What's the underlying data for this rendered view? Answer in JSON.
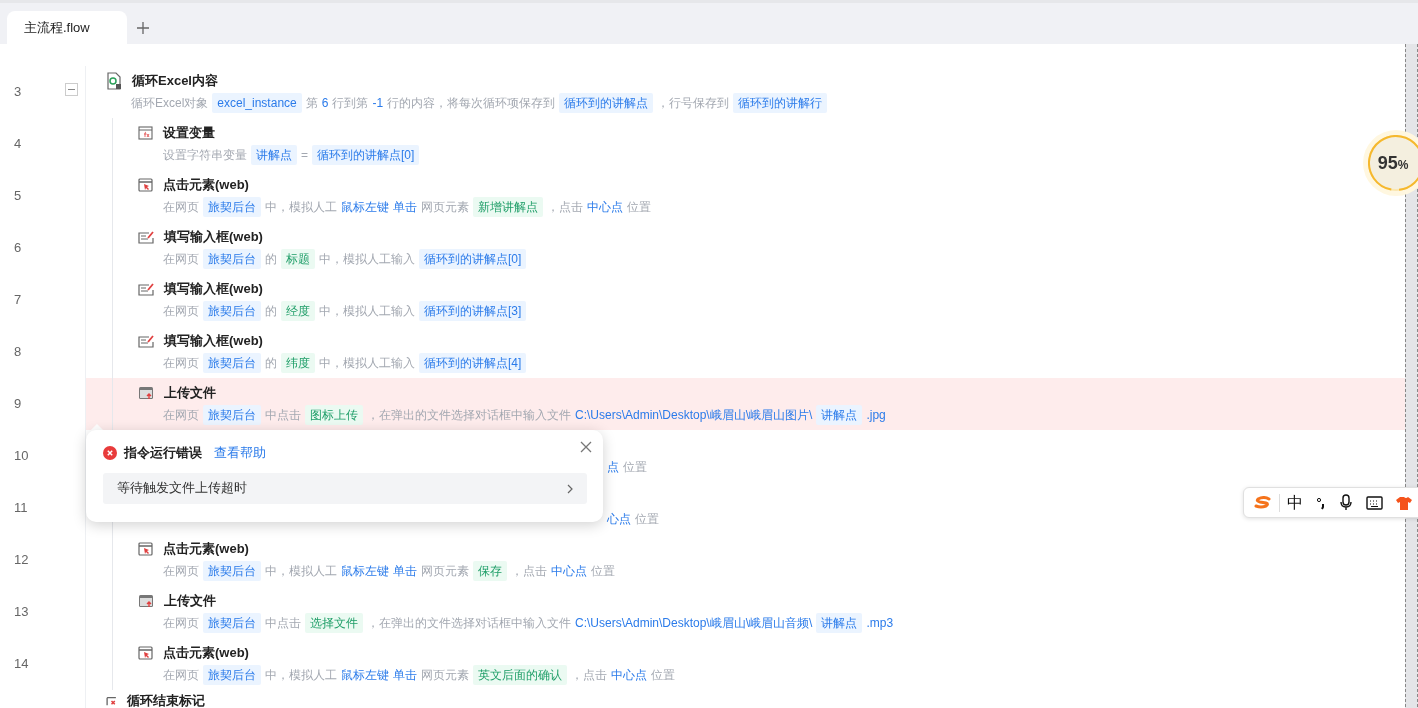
{
  "tabs": [
    {
      "label": "主流程.flow",
      "selected": true
    }
  ],
  "steps": [
    {
      "line": "3",
      "kind": "loop",
      "title": "循环Excel内容",
      "expanded": true,
      "error": false,
      "segments": [
        {
          "kind": "text",
          "text": "循环Excel对象"
        },
        {
          "kind": "var",
          "text": "excel_instance"
        },
        {
          "kind": "text",
          "text": "第"
        },
        {
          "kind": "value",
          "text": "6"
        },
        {
          "kind": "text",
          "text": "行到第"
        },
        {
          "kind": "value",
          "text": "-1"
        },
        {
          "kind": "text",
          "text": "行的内容，将每次循环项保存到"
        },
        {
          "kind": "var",
          "text": "循环到的讲解点"
        },
        {
          "kind": "text",
          "text": "，行号保存到"
        },
        {
          "kind": "var",
          "text": "循环到的讲解行"
        }
      ],
      "children": [
        {
          "line": "4",
          "kind": "set-var",
          "title": "设置变量",
          "error": false,
          "segments": [
            {
              "kind": "text",
              "text": "设置字符串变量"
            },
            {
              "kind": "var",
              "text": "讲解点"
            },
            {
              "kind": "text",
              "text": "="
            },
            {
              "kind": "var",
              "text": "循环到的讲解点[0]"
            }
          ]
        },
        {
          "line": "5",
          "kind": "click",
          "title": "点击元素(web)",
          "error": false,
          "segments": [
            {
              "kind": "text",
              "text": "在网页"
            },
            {
              "kind": "var",
              "text": "旅契后台"
            },
            {
              "kind": "text",
              "text": "中，模拟人工"
            },
            {
              "kind": "value",
              "text": "鼠标左键"
            },
            {
              "kind": "value",
              "text": "单击"
            },
            {
              "kind": "text",
              "text": "网页元素"
            },
            {
              "kind": "element",
              "text": "新增讲解点"
            },
            {
              "kind": "text",
              "text": "，点击"
            },
            {
              "kind": "value",
              "text": "中心点"
            },
            {
              "kind": "text",
              "text": "位置"
            }
          ]
        },
        {
          "line": "6",
          "kind": "input",
          "title": "填写输入框(web)",
          "error": false,
          "segments": [
            {
              "kind": "text",
              "text": "在网页"
            },
            {
              "kind": "var",
              "text": "旅契后台"
            },
            {
              "kind": "text",
              "text": "的"
            },
            {
              "kind": "element",
              "text": "标题"
            },
            {
              "kind": "text",
              "text": "中，模拟人工输入"
            },
            {
              "kind": "var",
              "text": "循环到的讲解点[0]"
            }
          ]
        },
        {
          "line": "7",
          "kind": "input",
          "title": "填写输入框(web)",
          "error": false,
          "segments": [
            {
              "kind": "text",
              "text": "在网页"
            },
            {
              "kind": "var",
              "text": "旅契后台"
            },
            {
              "kind": "text",
              "text": "的"
            },
            {
              "kind": "element",
              "text": "经度"
            },
            {
              "kind": "text",
              "text": "中，模拟人工输入"
            },
            {
              "kind": "var",
              "text": "循环到的讲解点[3]"
            }
          ]
        },
        {
          "line": "8",
          "kind": "input",
          "title": "填写输入框(web)",
          "error": false,
          "segments": [
            {
              "kind": "text",
              "text": "在网页"
            },
            {
              "kind": "var",
              "text": "旅契后台"
            },
            {
              "kind": "text",
              "text": "的"
            },
            {
              "kind": "element",
              "text": "纬度"
            },
            {
              "kind": "text",
              "text": "中，模拟人工输入"
            },
            {
              "kind": "var",
              "text": "循环到的讲解点[4]"
            }
          ]
        },
        {
          "line": "9",
          "kind": "upload",
          "title": "上传文件",
          "error": true,
          "segments": [
            {
              "kind": "text",
              "text": "在网页"
            },
            {
              "kind": "var",
              "text": "旅契后台"
            },
            {
              "kind": "text",
              "text": "中点击"
            },
            {
              "kind": "element",
              "text": "图标上传"
            },
            {
              "kind": "text",
              "text": "，在弹出的文件选择对话框中输入文件"
            },
            {
              "kind": "value",
              "text": "C:\\Users\\Admin\\Desktop\\峨眉山\\峨眉山图片\\"
            },
            {
              "kind": "var",
              "text": "讲解点"
            },
            {
              "kind": "value",
              "text": ".jpg"
            }
          ]
        },
        {
          "line": "10",
          "kind": "hidden",
          "obscured": true,
          "error": false,
          "segments": [
            {
              "kind": "value",
              "text": "点"
            },
            {
              "kind": "text",
              "text": "位置"
            }
          ]
        },
        {
          "line": "11",
          "kind": "hidden",
          "obscured": true,
          "error": false,
          "segments": [
            {
              "kind": "value",
              "text": "心点"
            },
            {
              "kind": "text",
              "text": "位置"
            }
          ]
        },
        {
          "line": "12",
          "kind": "click",
          "title": "点击元素(web)",
          "error": false,
          "segments": [
            {
              "kind": "text",
              "text": "在网页"
            },
            {
              "kind": "var",
              "text": "旅契后台"
            },
            {
              "kind": "text",
              "text": "中，模拟人工"
            },
            {
              "kind": "value",
              "text": "鼠标左键"
            },
            {
              "kind": "value",
              "text": "单击"
            },
            {
              "kind": "text",
              "text": "网页元素"
            },
            {
              "kind": "element",
              "text": "保存"
            },
            {
              "kind": "text",
              "text": "，点击"
            },
            {
              "kind": "value",
              "text": "中心点"
            },
            {
              "kind": "text",
              "text": "位置"
            }
          ]
        },
        {
          "line": "13",
          "kind": "upload",
          "title": "上传文件",
          "error": false,
          "segments": [
            {
              "kind": "text",
              "text": "在网页"
            },
            {
              "kind": "var",
              "text": "旅契后台"
            },
            {
              "kind": "text",
              "text": "中点击"
            },
            {
              "kind": "element",
              "text": "选择文件"
            },
            {
              "kind": "text",
              "text": "，在弹出的文件选择对话框中输入文件"
            },
            {
              "kind": "value",
              "text": "C:\\Users\\Admin\\Desktop\\峨眉山\\峨眉山音频\\"
            },
            {
              "kind": "var",
              "text": "讲解点"
            },
            {
              "kind": "value",
              "text": ".mp3"
            }
          ]
        },
        {
          "line": "14",
          "kind": "click",
          "title": "点击元素(web)",
          "error": false,
          "segments": [
            {
              "kind": "text",
              "text": "在网页"
            },
            {
              "kind": "var",
              "text": "旅契后台"
            },
            {
              "kind": "text",
              "text": "中，模拟人工"
            },
            {
              "kind": "value",
              "text": "鼠标左键"
            },
            {
              "kind": "value",
              "text": "单击"
            },
            {
              "kind": "text",
              "text": "网页元素"
            },
            {
              "kind": "element",
              "text": "英文后面的确认"
            },
            {
              "kind": "text",
              "text": "，点击"
            },
            {
              "kind": "value",
              "text": "中心点"
            },
            {
              "kind": "text",
              "text": "位置"
            }
          ]
        }
      ]
    },
    {
      "kind": "loop-end",
      "title": "循环结束标记",
      "error": false
    }
  ],
  "error_popup": {
    "title": "指令运行错误",
    "help_link": "查看帮助",
    "message": "等待触发文件上传超时"
  },
  "progress_badge": {
    "value": "95",
    "unit": "%",
    "level": 0.95
  },
  "ime_toolbar": {
    "mode": "中"
  }
}
